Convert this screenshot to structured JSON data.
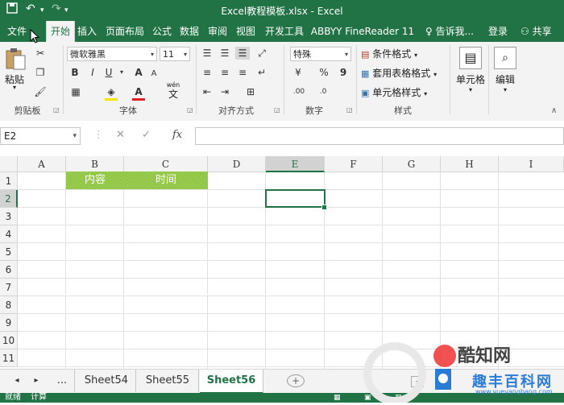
{
  "window": {
    "title": "Excel教程模板.xlsx - Excel"
  },
  "quick_access": {
    "save_icon": "save-icon",
    "undo_icon": "undo-icon",
    "redo_icon": "redo-icon"
  },
  "menu": {
    "file": "文件",
    "tabs": [
      "开始",
      "插入",
      "页面布局",
      "公式",
      "数据",
      "审阅",
      "视图",
      "开发工具",
      "ABBYY FineReader 11"
    ],
    "tell_me": "告诉我...",
    "signin": "登录",
    "share": "共享"
  },
  "ribbon": {
    "clipboard": {
      "paste": "粘贴",
      "group": "剪贴板"
    },
    "font": {
      "name": "微软雅黑",
      "size": "11",
      "group": "字体",
      "bold": "B",
      "italic": "I",
      "underline": "U",
      "wen": "wén",
      "wen_char": "文",
      "grow": "A",
      "shrink": "A"
    },
    "alignment": {
      "group": "对齐方式"
    },
    "number": {
      "format": "特殊",
      "percent": "%",
      "comma": "9",
      "group": "数字"
    },
    "styles": {
      "conditional": "条件格式",
      "table": "套用表格格式",
      "cell": "单元格样式",
      "group": "样式"
    },
    "cells": {
      "label": "单元格"
    },
    "editing": {
      "label": "编辑"
    }
  },
  "formula_bar": {
    "name_box": "E2",
    "cancel": "✕",
    "enter": "✓",
    "fx": "fx",
    "content": ""
  },
  "grid": {
    "columns": [
      "A",
      "B",
      "C",
      "D",
      "E",
      "F",
      "G",
      "H",
      "I"
    ],
    "rows": [
      "1",
      "2",
      "3",
      "4",
      "5",
      "6",
      "7",
      "8",
      "9",
      "10",
      "11"
    ],
    "cells": {
      "B1": "内容",
      "C1": "时间"
    },
    "selected": "E2",
    "header_fill": "#8fc641"
  },
  "sheets": {
    "nav_prev": "◂",
    "nav_next": "▸",
    "ellipsis": "...",
    "tabs": [
      "Sheet54",
      "Sheet55",
      "Sheet56"
    ],
    "active": "Sheet56",
    "add": "+"
  },
  "status": {
    "left1": "就绪",
    "left2": "计算"
  },
  "watermark": {
    "logo_text": "酷知网",
    "brand": "趣丰百科网",
    "url": "www.yueyangbang.com"
  },
  "colors": {
    "accent": "#217346",
    "ribbon_bg": "#f3f3f3"
  }
}
